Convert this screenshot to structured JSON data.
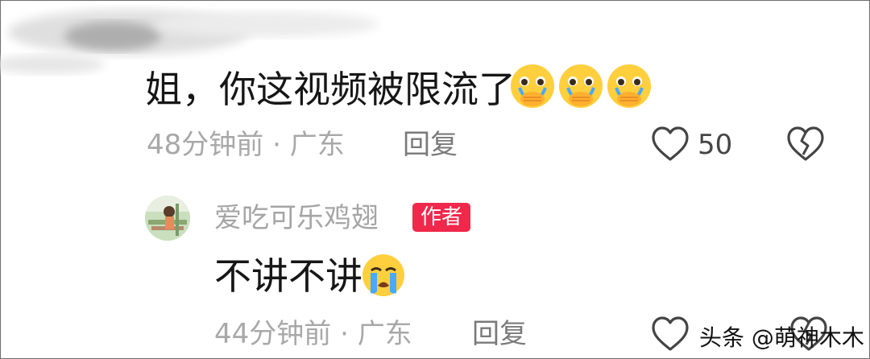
{
  "comments": [
    {
      "text": "姐，你这视频被限流了",
      "emoji": [
        "crying-covering-mouth-emoji",
        "crying-covering-mouth-emoji",
        "crying-covering-mouth-emoji"
      ],
      "time": "48分钟前",
      "separator": "·",
      "location": "广东",
      "reply_label": "回复",
      "likes": "50"
    },
    {
      "username": "爱吃可乐鸡翅",
      "badge": "作者",
      "text": "不讲不讲",
      "emoji": [
        "loudly-crying-emoji"
      ],
      "time": "44分钟前",
      "separator": "·",
      "location": "广东",
      "reply_label": "回复"
    }
  ],
  "watermark": "头条 @萌神木木",
  "colors": {
    "badge": "#f0284b",
    "meta_text": "#a8a8a8",
    "body_text": "#161616"
  }
}
